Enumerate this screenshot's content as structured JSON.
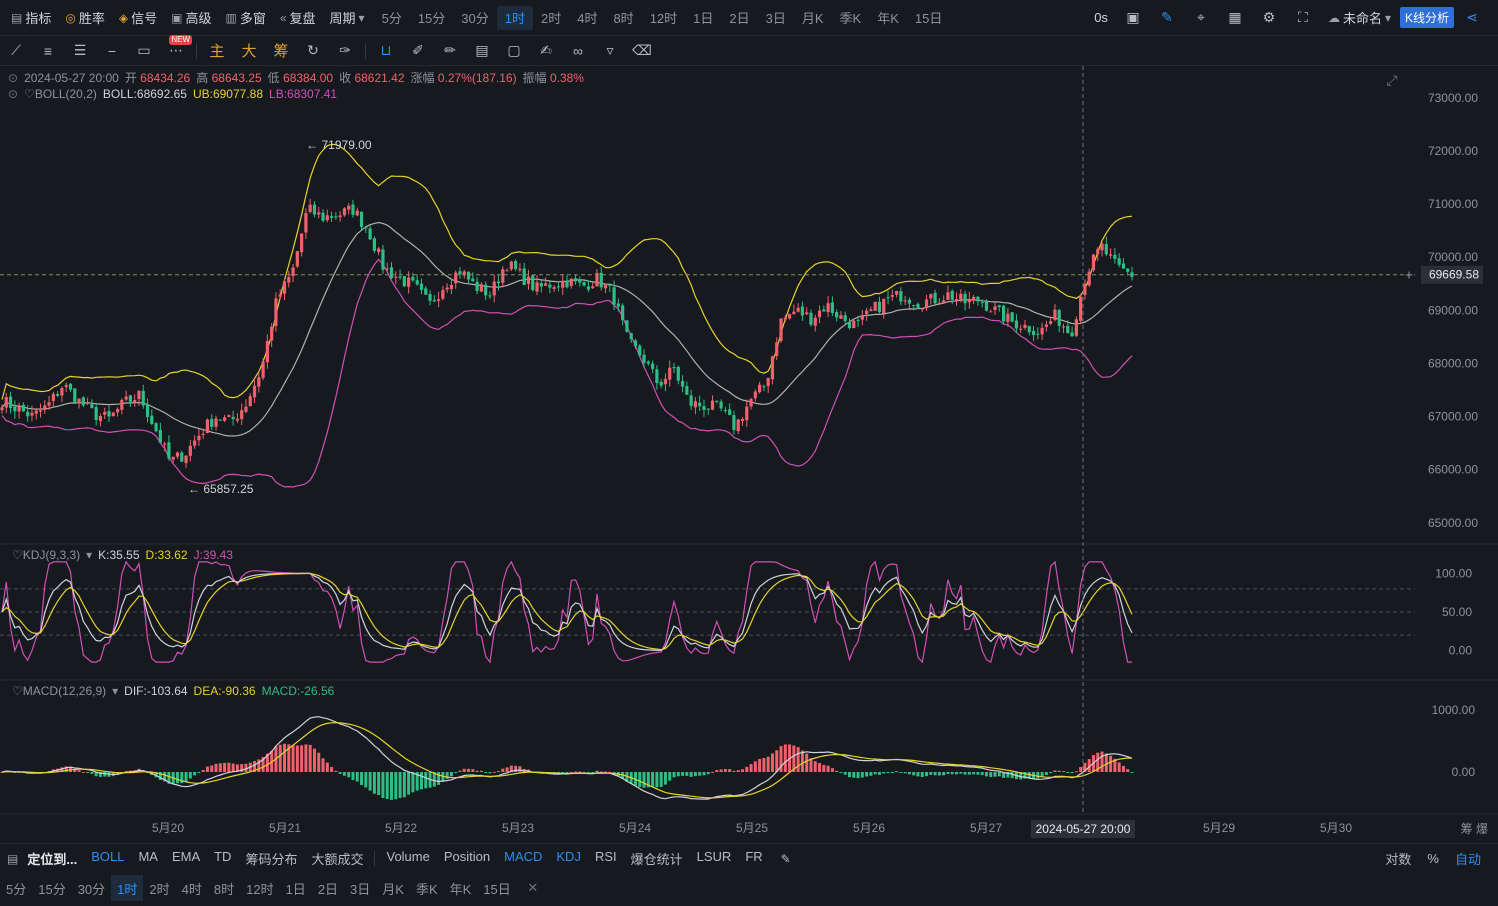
{
  "topbar": {
    "items": [
      {
        "icon": "indicator-icon",
        "label": "指标"
      },
      {
        "icon": "winrate-icon",
        "label": "胜率"
      },
      {
        "icon": "signal-icon",
        "label": "信号"
      },
      {
        "icon": "advanced-icon",
        "label": "高级"
      },
      {
        "icon": "multi-window-icon",
        "label": "多窗"
      },
      {
        "icon": "replay-icon",
        "label": "复盘"
      },
      {
        "icon": "chevron-down-icon",
        "label": "周期"
      }
    ],
    "periods": [
      "5分",
      "15分",
      "30分",
      "1时",
      "2时",
      "4时",
      "8时",
      "12时",
      "1日",
      "2日",
      "3日",
      "月K",
      "季K",
      "年K",
      "15日"
    ],
    "active_period": "1时",
    "countdown": "0s",
    "layout_name": "未命名",
    "k_analysis": "K线分析"
  },
  "toolbar": {
    "new_badge": "NEW",
    "chinese_tools": [
      "主",
      "大",
      "筹"
    ]
  },
  "info": {
    "datetime": "2024-05-27 20:00",
    "open_label": "开",
    "open": "68434.26",
    "high_label": "高",
    "high": "68643.25",
    "low_label": "低",
    "low": "68384.00",
    "close_label": "收",
    "close": "68621.42",
    "change_label": "涨幅",
    "change": "0.27%(187.16)",
    "amp_label": "振幅",
    "amp": "0.38%"
  },
  "boll": {
    "name": "BOLL(20,2)",
    "mid": "BOLL:68692.65",
    "ub": "UB:69077.88",
    "lb": "LB:68307.41"
  },
  "kdj": {
    "name": "KDJ(9,3,3)",
    "k": "K:35.55",
    "d": "D:33.62",
    "j": "J:39.43"
  },
  "macd": {
    "name": "MACD(12,26,9)",
    "dif": "DIF:-103.64",
    "dea": "DEA:-90.36",
    "macd": "MACD:-26.56"
  },
  "annotations": {
    "high_mark": "← 71979.00",
    "low_mark": "← 65857.25",
    "current_price": "69669.58",
    "crosshair_time": "2024-05-27 20:00"
  },
  "chart_data": {
    "type": "candlestick",
    "interval": "1时",
    "price_axis": [
      "73000.00",
      "72000.00",
      "71000.00",
      "70000.00",
      "69000.00",
      "68000.00",
      "67000.00",
      "66000.00",
      "65000.00"
    ],
    "price_range": [
      64600,
      73600
    ],
    "kdj_axis": [
      "100.00",
      "50.00",
      "0.00"
    ],
    "macd_axis": [
      "1000.00",
      "0.00"
    ],
    "x_labels": [
      "5月20",
      "5月21",
      "5月22",
      "5月23",
      "5月24",
      "5月25",
      "5月26",
      "5月27",
      "5月29",
      "5月30"
    ],
    "x_right_label": "筹 爆",
    "close_path": [
      67300,
      67150,
      67000,
      67200,
      67600,
      67300,
      67050,
      66950,
      67250,
      67400,
      66800,
      66150,
      66300,
      66700,
      67000,
      66900,
      67250,
      67900,
      69200,
      69700,
      70900,
      70750,
      70800,
      70900,
      70500,
      69800,
      69600,
      69450,
      69100,
      69500,
      69750,
      69450,
      69300,
      69900,
      69650,
      69400,
      69500,
      69550,
      69450,
      69600,
      69300,
      68400,
      68100,
      67600,
      67900,
      67250,
      67200,
      67150,
      66800,
      67300,
      67600,
      68800,
      69000,
      68850,
      69100,
      68850,
      68700,
      69000,
      69200,
      69300,
      69150,
      69200,
      69300,
      69150,
      69200,
      69000,
      68800,
      68700,
      68600,
      68900,
      68550,
      69700,
      70200,
      69800,
      69670
    ],
    "high": 71979.0,
    "low": 65857.25,
    "last_price": 69669.58
  },
  "bottom": {
    "locate": "定位到...",
    "indicators": [
      {
        "label": "BOLL",
        "on": true
      },
      {
        "label": "MA",
        "on": false
      },
      {
        "label": "EMA",
        "on": false
      },
      {
        "label": "TD",
        "on": false
      },
      {
        "label": "筹码分布",
        "on": false
      },
      {
        "label": "大额成交",
        "on": false
      }
    ],
    "sub_indicators": [
      {
        "label": "Volume",
        "on": false
      },
      {
        "label": "Position",
        "on": false
      },
      {
        "label": "MACD",
        "on": true
      },
      {
        "label": "KDJ",
        "on": true
      },
      {
        "label": "RSI",
        "on": false
      },
      {
        "label": "爆仓统计",
        "on": false
      },
      {
        "label": "LSUR",
        "on": false
      },
      {
        "label": "FR",
        "on": false
      }
    ],
    "right": [
      "对数",
      "%",
      "自动"
    ],
    "periods": [
      "5分",
      "15分",
      "30分",
      "1时",
      "2时",
      "4时",
      "8时",
      "12时",
      "1日",
      "2日",
      "3日",
      "月K",
      "季K",
      "年K",
      "15日"
    ],
    "active_period": "1时"
  },
  "colors": {
    "up": "#f0616d",
    "down": "#2ebd85",
    "boll_mid": "#b0b0b0",
    "boll_ub": "#e6d22c",
    "boll_lb": "#d14fb8",
    "accent": "#2f8cf0"
  }
}
